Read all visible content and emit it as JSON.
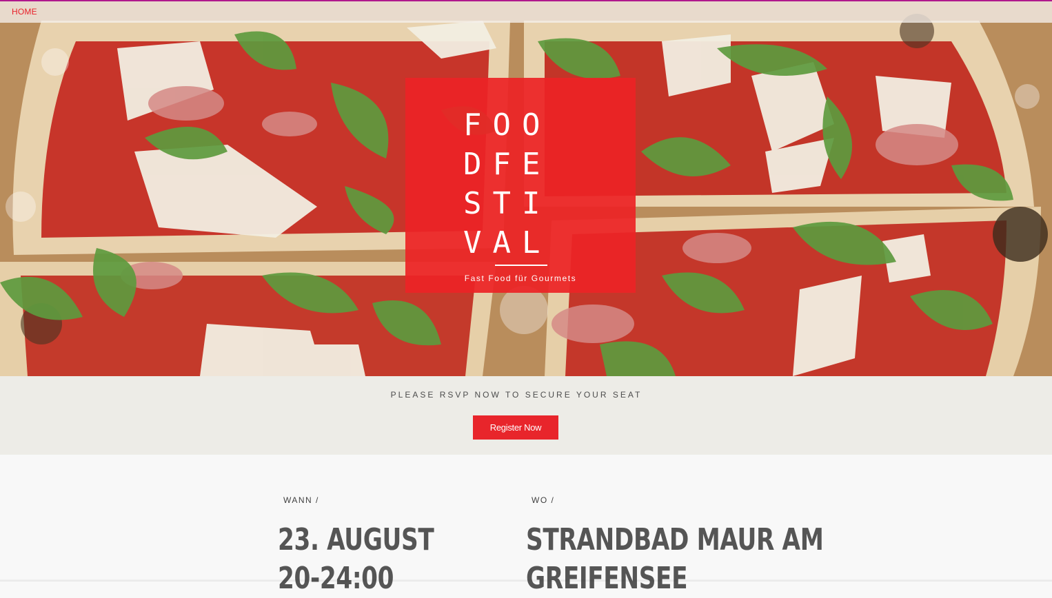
{
  "nav": {
    "home_label": "HOME"
  },
  "hero": {
    "title_lines": [
      "FOO",
      "DFE",
      "STI",
      "VAL"
    ],
    "subtitle": "Fast Food für Gourmets"
  },
  "rsvp": {
    "text": "PLEASE RSVP NOW TO SECURE YOUR SEAT",
    "button_label": "Register Now"
  },
  "details": {
    "when": {
      "label": "WANN /",
      "line1": "23. AUGUST",
      "line2": "20-24:00"
    },
    "where": {
      "label": "WO /",
      "line1": "STRANDBAD MAUR AM",
      "line2": "GREIFENSEE"
    }
  },
  "colors": {
    "accent_red": "#e8252b",
    "nav_border": "#b0188c",
    "rsvp_bg": "#edece7"
  }
}
